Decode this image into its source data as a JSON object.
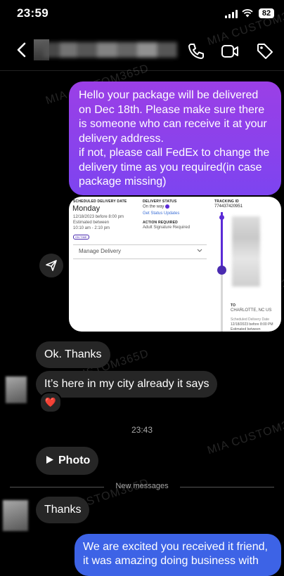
{
  "status_bar": {
    "time": "23:59",
    "battery": "82"
  },
  "header": {
    "contact_name": "",
    "icons": [
      "back-icon",
      "phone-icon",
      "video-icon",
      "tag-icon"
    ]
  },
  "watermark": "MIA CUSTOM365D",
  "messages": {
    "sent_1": {
      "para1": "Hello your package will be delivered on Dec 18th. Please make sure there is someone who can receive it at your delivery address.",
      "para2": "if not, please call FedEx to change the delivery time as you required(in case package missing)"
    },
    "screenshot_card": {
      "col1_label": "SCHEDULED DELIVERY DATE",
      "day": "Monday",
      "date_line": "12/18/2023 before 8:00 pm",
      "estimated": "Estimated between",
      "time_window": "10:10 am - 2:10 pm",
      "on_time": "ON TIME",
      "col2_label": "DELIVERY STATUS",
      "status": "On the way",
      "get_updates": "Get Status Updates",
      "action_label": "ACTION REQUIRED",
      "action_value": "Adult Signature Required",
      "col3_label": "TRACKING ID",
      "tracking_id": "774437420951",
      "manage": "Manage Delivery",
      "to_label": "TO",
      "to_city": "CHARLOTTE, NC US",
      "sched_label": "Scheduled Delivery Date",
      "sched_value": "12/18/2023 before 8:00 PM",
      "est_between": "Estimated between"
    },
    "recv_1": "Ok. Thanks",
    "recv_2": "It’s here in my city already it says",
    "reaction": "❤️",
    "timestamp": "23:43",
    "photo_label": "Photo",
    "new_messages": "New messages",
    "recv_3": "Thanks",
    "sent_2": "We are excited you received it friend, it was amazing doing business with"
  },
  "colors": {
    "sent_top": "#9b3fe6",
    "sent_bottom": "#7d44f0",
    "received": "#262626",
    "accent": "#5b2bd6"
  }
}
